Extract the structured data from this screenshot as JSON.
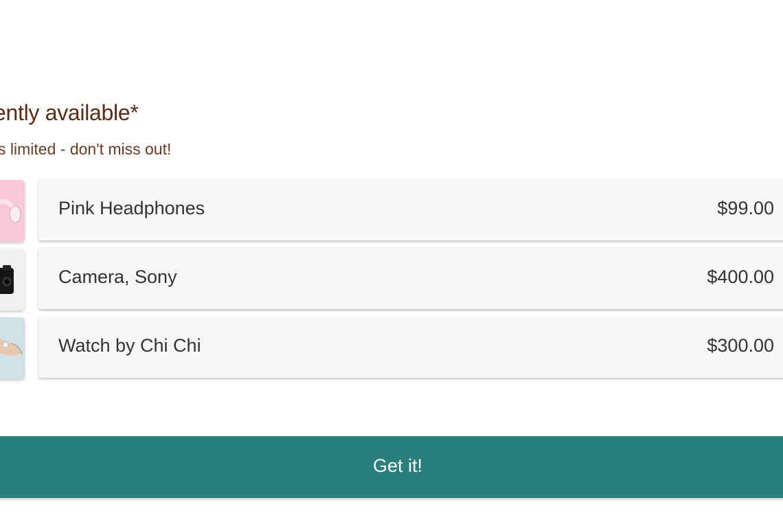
{
  "header": {
    "title": "Currently available*",
    "subtitle": "Stock is limited - don't miss out!"
  },
  "products": [
    {
      "name": "Pink Headphones",
      "price": "$99.00",
      "thumbnail_icon": "headphones-icon",
      "thumbnail_color": "#f8c9d9"
    },
    {
      "name": "Camera, Sony",
      "price": "$400.00",
      "thumbnail_icon": "camera-icon",
      "thumbnail_color": "#f1f1f1"
    },
    {
      "name": "Watch by Chi Chi",
      "price": "$300.00",
      "thumbnail_icon": "watch-icon",
      "thumbnail_color": "#cfe2e6"
    }
  ],
  "cta": {
    "label": "Get it!",
    "color": "#2a7f7e"
  },
  "colors": {
    "heading": "#5a2a12",
    "card_background": "#f7f7f7",
    "text": "#333333"
  }
}
